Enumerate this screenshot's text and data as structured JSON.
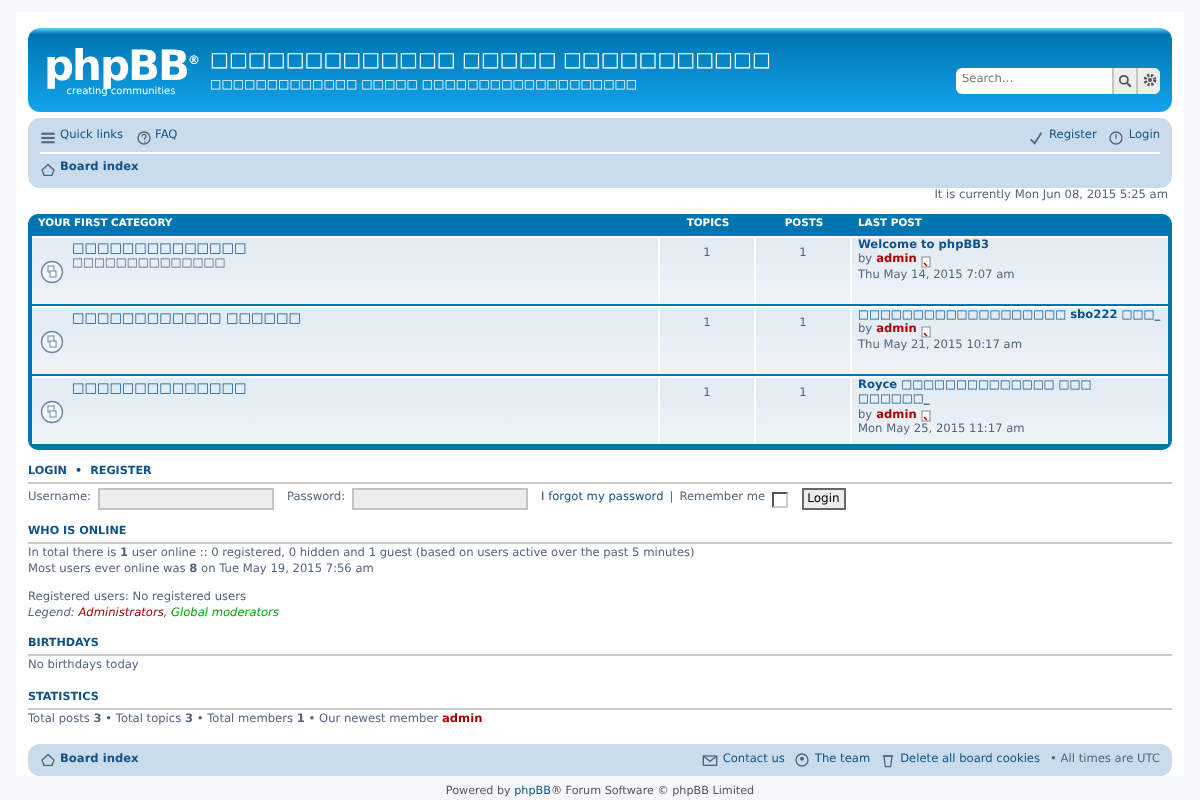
{
  "header": {
    "logo": {
      "name": "phpBB$^{®}$",
      "tagline": "creating communities"
    },
    "site_title": "□□□□□□□□□□□□□ □□□□□ □□□□□□□□□□□",
    "site_description": "□□□□□□□□□□□□□ □□□□□ □□□□□□□□□□□□□□□□□□□",
    "search": {
      "placeholder": "Search…"
    }
  },
  "nav": {
    "left": [
      {
        "kind": "menu",
        "label": "Quick links"
      },
      {
        "kind": "faq",
        "label": "FAQ"
      }
    ],
    "right": [
      {
        "kind": "register",
        "label": "Register"
      },
      {
        "kind": "login",
        "label": "Login"
      }
    ],
    "breadcrumb": "Board index"
  },
  "current_time": "It is currently Mon Jun 08, 2015 5:25 am",
  "forums": {
    "category": "YOUR FIRST CATEGORY",
    "columns": [
      "TOPICS",
      "POSTS",
      "LAST POST"
    ],
    "rows": [
      {
        "title": "□□□□□□□□□□□□□□",
        "description": "□□□□□□□□□□□□□□",
        "topics": "1",
        "posts": "1",
        "last_post": {
          "title": "Welcome to phpBB3",
          "by": "by",
          "author": "admin",
          "time": "Thu May 14, 2015 7:07 am"
        }
      },
      {
        "title": "□□□□□□□□□□□□ □□□□□□",
        "topics": "1",
        "posts": "1",
        "last_post": {
          "title": "□□□□□□□□□□□□□□□□□□□ sbo222 □□□_",
          "by": "by",
          "author": "admin",
          "time": "Thu May 21, 2015 10:17 am"
        }
      },
      {
        "title": "□□□□□□□□□□□□□□",
        "topics": "1",
        "posts": "1",
        "last_post": {
          "title": "Royce □□□□□□□□□□□□□□ □□□ □□□□□□_",
          "by": "by",
          "author": "admin",
          "time": "Mon May 25, 2015 11:17 am"
        }
      }
    ]
  },
  "login": {
    "login_link": "LOGIN",
    "separator": "•",
    "register_link": "REGISTER",
    "username_label": "Username:",
    "password_label": "Password:",
    "forgot_link": "I forgot my password",
    "divider": "|",
    "remember_label": "Remember me",
    "remember_checked": false,
    "button": "Login"
  },
  "who_is_online": {
    "heading": "WHO IS ONLINE",
    "lines": [
      "In total there is **1** user online :: 0 registered, 0 hidden and 1 guest (based on users active over the past 5 minutes)",
      "Most users ever online was **8** on Tue May 19, 2015 7:56 am"
    ],
    "registered": "Registered users: No registered users",
    "legend": {
      "label": "Legend:",
      "separator": ",",
      "groups": [
        {
          "name": "Administrators",
          "color": "#aa0000"
        },
        {
          "name": "Global moderators",
          "color": "#00aa00"
        }
      ]
    }
  },
  "birthdays": {
    "heading": "BIRTHDAYS",
    "text": "No birthdays today"
  },
  "statistics": {
    "heading": "STATISTICS",
    "text": "Total posts **3** • Total topics **3** • Total members **1** • Our newest member",
    "newest_member": "admin"
  },
  "footer": {
    "breadcrumb": "Board index",
    "links": [
      {
        "kind": "contact",
        "label": "Contact us"
      },
      {
        "kind": "team",
        "label": "The team"
      },
      {
        "kind": "cookies",
        "label": "Delete all board cookies"
      }
    ],
    "timezone": "• All times are UTC"
  },
  "credits": {
    "prefix": "Powered by",
    "link": "phpBB",
    "suffix": "® Forum Software © phpBB Limited"
  }
}
